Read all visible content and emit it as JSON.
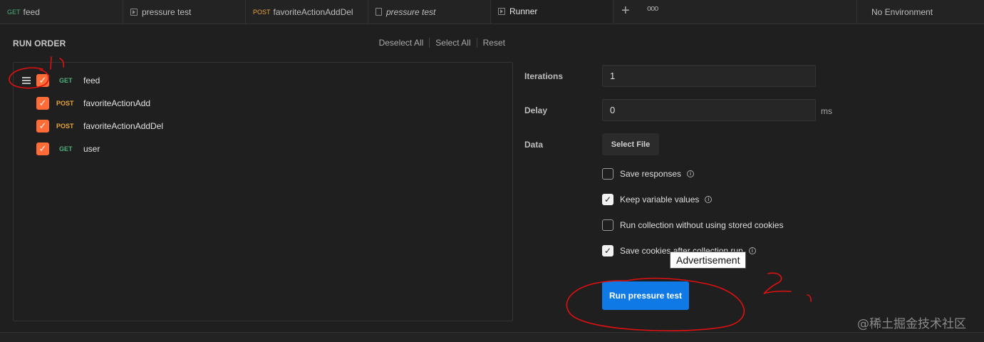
{
  "tabs": [
    {
      "method": "GET",
      "label": "feed",
      "icon": "",
      "italic": false
    },
    {
      "method": "",
      "label": "pressure test",
      "icon": "play-icon",
      "italic": false
    },
    {
      "method": "POST",
      "label": "favoriteActionAddDel",
      "icon": "",
      "italic": false
    },
    {
      "method": "",
      "label": "pressure test",
      "icon": "document-icon",
      "italic": true
    },
    {
      "method": "",
      "label": "Runner",
      "icon": "play-icon",
      "italic": false,
      "active": true
    }
  ],
  "tab_actions": {
    "add": "+",
    "more": "ooo"
  },
  "environment": "No Environment",
  "run_order": {
    "title": "RUN ORDER",
    "deselect_all": "Deselect All",
    "select_all": "Select All",
    "reset": "Reset",
    "requests": [
      {
        "method": "GET",
        "name": "feed",
        "checked": true
      },
      {
        "method": "POST",
        "name": "favoriteActionAdd",
        "checked": true
      },
      {
        "method": "POST",
        "name": "favoriteActionAddDel",
        "checked": true
      },
      {
        "method": "GET",
        "name": "user",
        "checked": true
      }
    ]
  },
  "settings": {
    "iterations_label": "Iterations",
    "iterations_value": "1",
    "delay_label": "Delay",
    "delay_value": "0",
    "delay_unit": "ms",
    "data_label": "Data",
    "select_file": "Select File",
    "options": [
      {
        "label": "Save responses",
        "checked": false,
        "info": true
      },
      {
        "label": "Keep variable values",
        "checked": true,
        "info": true
      },
      {
        "label": "Run collection without using stored cookies",
        "checked": false,
        "info": false
      },
      {
        "label": "Save cookies after collection run",
        "checked": true,
        "info": true
      }
    ],
    "run_button": "Run pressure test"
  },
  "tooltip": "Advertisement",
  "watermark": "@稀土掘金技术社区",
  "colors": {
    "accent_orange": "#ff6c37",
    "run_blue": "#0f7ae5",
    "get_green": "#4caf7a",
    "post_orange": "#e8a33d",
    "annotation_red": "#e01010"
  }
}
